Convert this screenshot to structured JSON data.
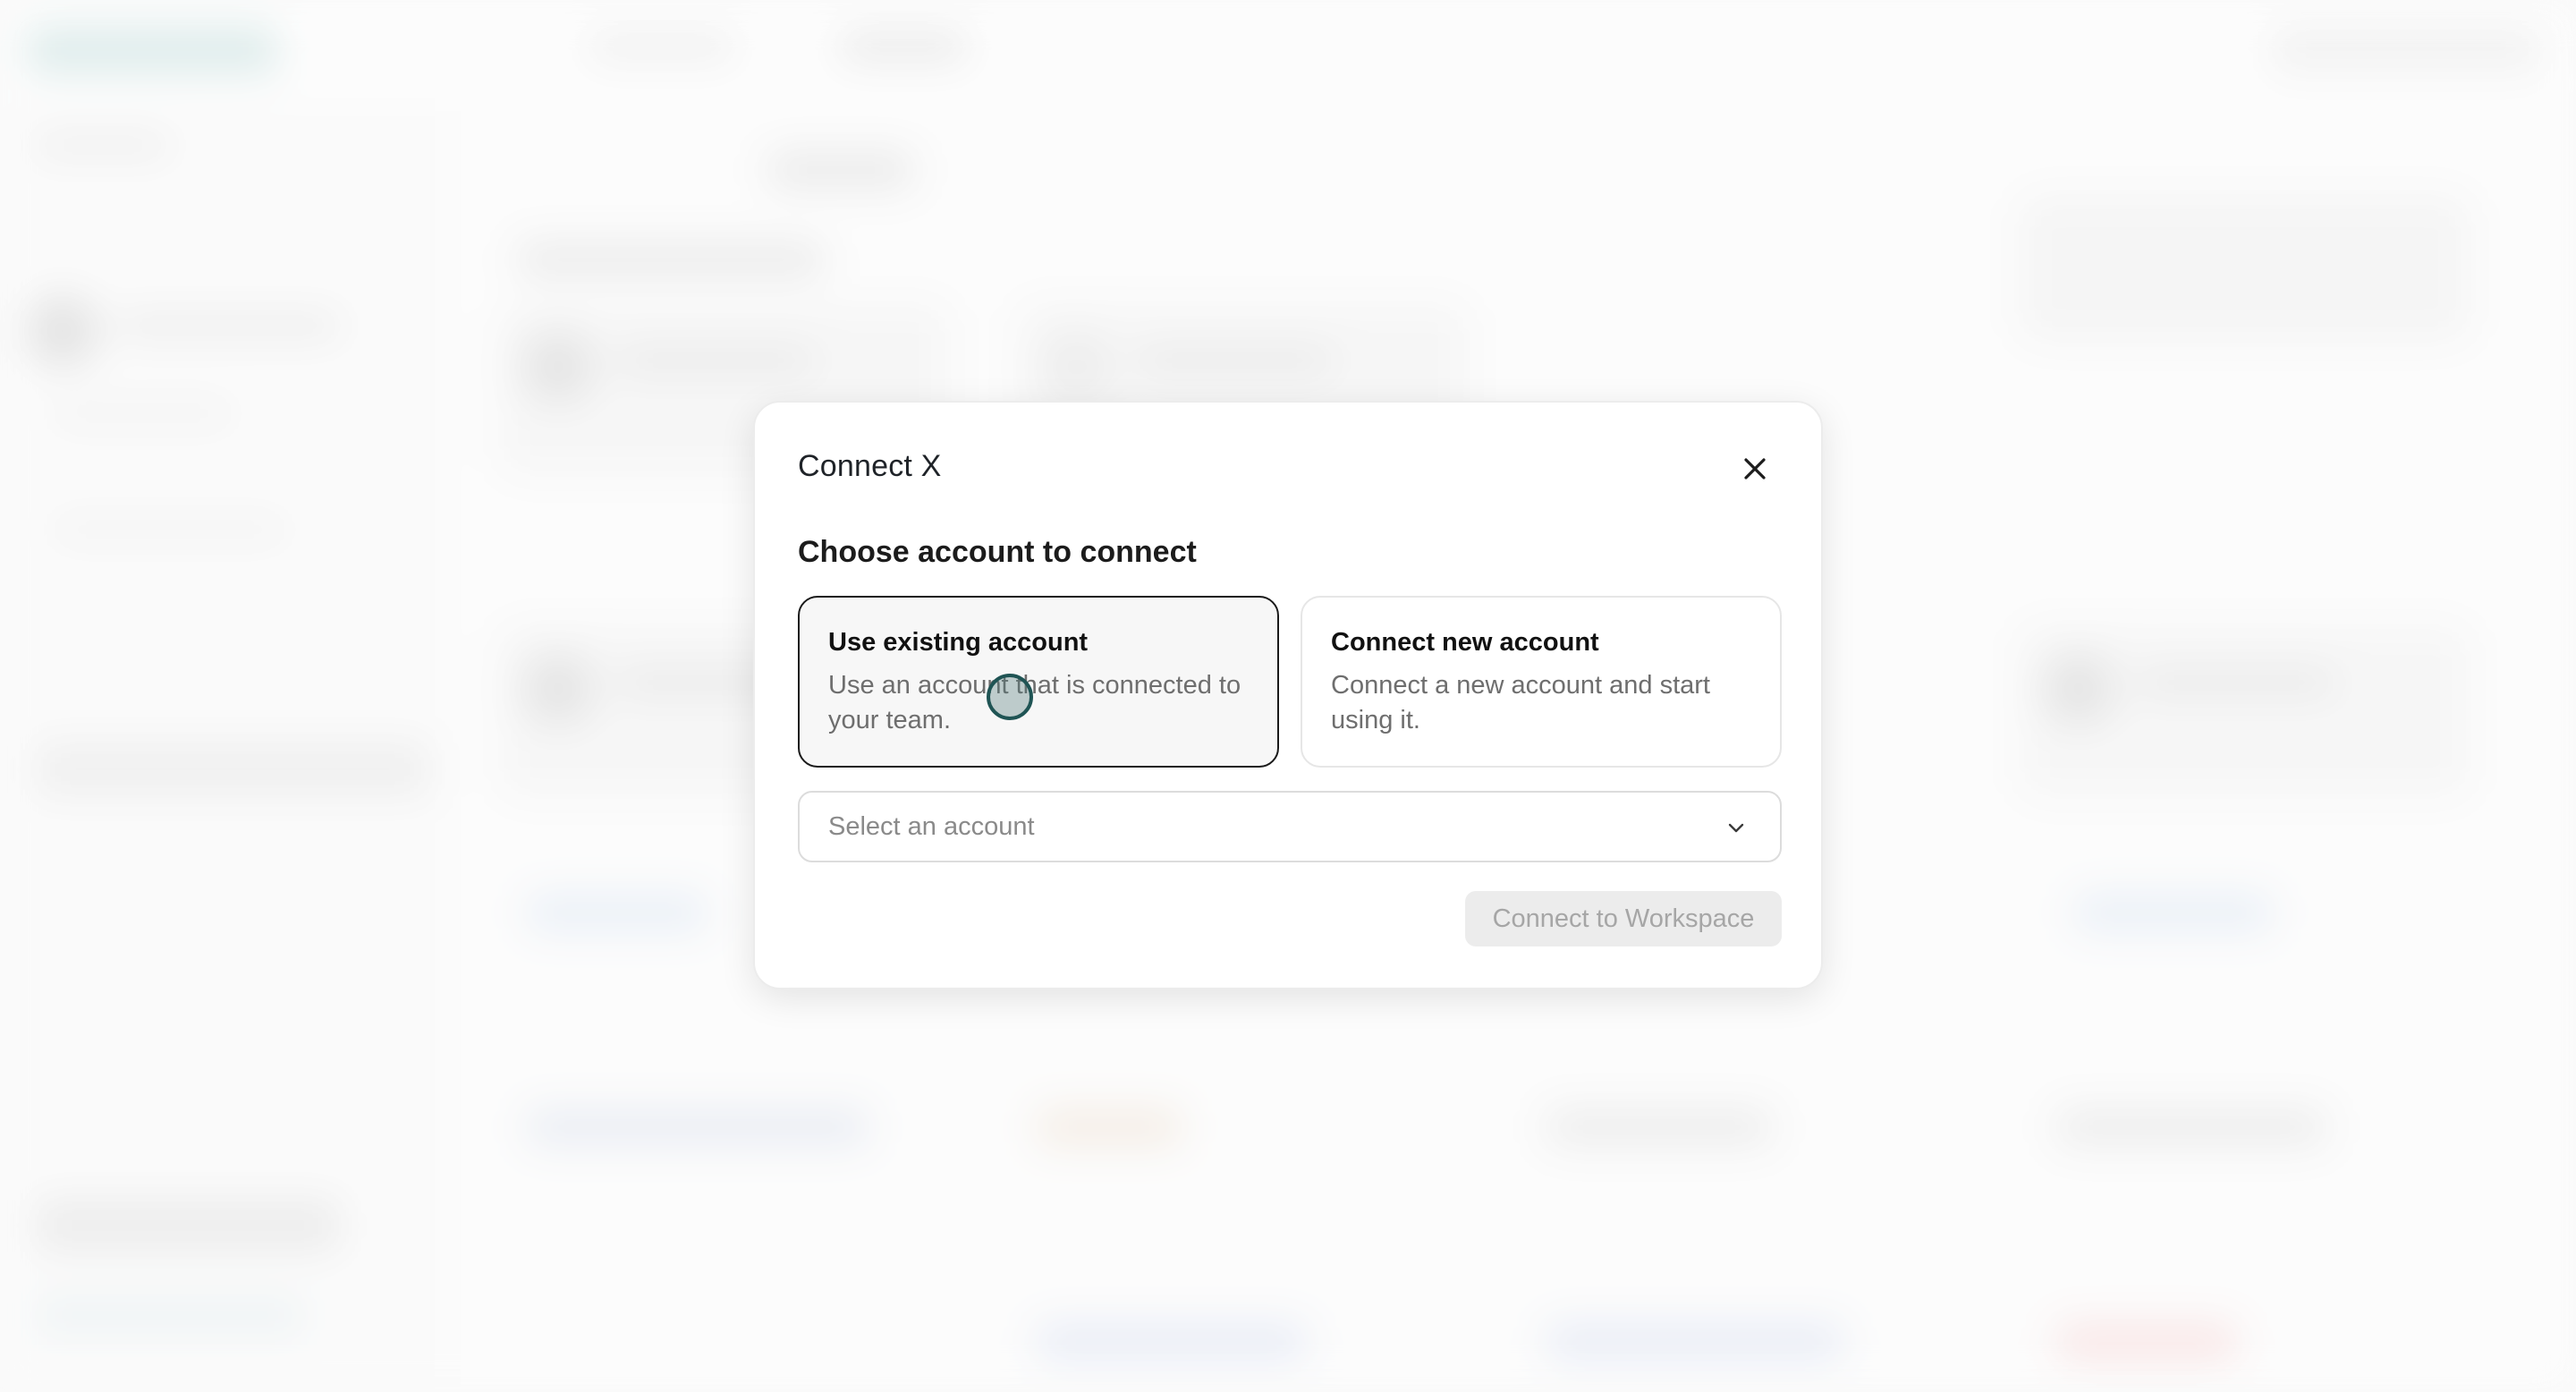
{
  "modal": {
    "title": "Connect X",
    "close_icon": "close-icon",
    "section_title": "Choose account to connect",
    "options": [
      {
        "title": "Use existing account",
        "description": "Use an account that is connected to your team.",
        "selected": true
      },
      {
        "title": "Connect new account",
        "description": "Connect a new account and start using it.",
        "selected": false
      }
    ],
    "select": {
      "placeholder": "Select an account",
      "icon": "chevron-down-icon"
    },
    "primary_button": {
      "label": "Connect to Workspace",
      "disabled": true
    }
  },
  "colors": {
    "selected_border": "#1a1a1a",
    "disabled_button_bg": "#ececec",
    "disabled_button_text": "#a6a6a6",
    "cursor_ring": "#1f5454"
  }
}
